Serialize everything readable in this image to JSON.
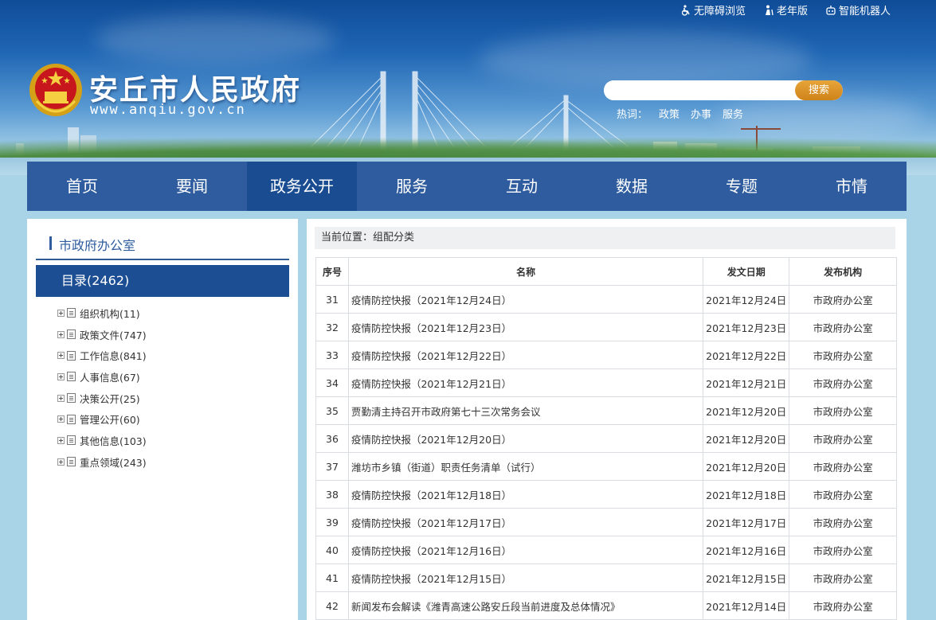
{
  "toplinks": {
    "accessible": "无障碍浏览",
    "elderly": "老年版",
    "robot": "智能机器人"
  },
  "site": {
    "title": "安丘市人民政府",
    "url": "www.anqiu.gov.cn"
  },
  "search": {
    "placeholder": "",
    "button": "搜索"
  },
  "hotwords": {
    "label": "热词：",
    "items": [
      "政策",
      "办事",
      "服务"
    ]
  },
  "nav": [
    "首页",
    "要闻",
    "政务公开",
    "服务",
    "互动",
    "数据",
    "专题",
    "市情"
  ],
  "nav_active": "政务公开",
  "sidebar": {
    "title": "市政府办公室",
    "catalog": "目录(2462)",
    "tree": [
      "组织机构(11)",
      "政策文件(747)",
      "工作信息(841)",
      "人事信息(67)",
      "决策公开(25)",
      "管理公开(60)",
      "其他信息(103)",
      "重点领域(243)"
    ]
  },
  "breadcrumb": "当前位置：组配分类",
  "table": {
    "headers": {
      "no": "序号",
      "name": "名称",
      "date": "发文日期",
      "org": "发布机构"
    },
    "rows": [
      {
        "no": "31",
        "name": "疫情防控快报（2021年12月24日）",
        "date": "2021年12月24日",
        "org": "市政府办公室"
      },
      {
        "no": "32",
        "name": "疫情防控快报（2021年12月23日）",
        "date": "2021年12月23日",
        "org": "市政府办公室"
      },
      {
        "no": "33",
        "name": "疫情防控快报（2021年12月22日）",
        "date": "2021年12月22日",
        "org": "市政府办公室"
      },
      {
        "no": "34",
        "name": "疫情防控快报（2021年12月21日）",
        "date": "2021年12月21日",
        "org": "市政府办公室"
      },
      {
        "no": "35",
        "name": "贾勤清主持召开市政府第七十三次常务会议",
        "date": "2021年12月20日",
        "org": "市政府办公室"
      },
      {
        "no": "36",
        "name": "疫情防控快报（2021年12月20日）",
        "date": "2021年12月20日",
        "org": "市政府办公室"
      },
      {
        "no": "37",
        "name": "潍坊市乡镇（街道）职责任务清单（试行）",
        "date": "2021年12月20日",
        "org": "市政府办公室"
      },
      {
        "no": "38",
        "name": "疫情防控快报（2021年12月18日）",
        "date": "2021年12月18日",
        "org": "市政府办公室"
      },
      {
        "no": "39",
        "name": "疫情防控快报（2021年12月17日）",
        "date": "2021年12月17日",
        "org": "市政府办公室"
      },
      {
        "no": "40",
        "name": "疫情防控快报（2021年12月16日）",
        "date": "2021年12月16日",
        "org": "市政府办公室"
      },
      {
        "no": "41",
        "name": "疫情防控快报（2021年12月15日）",
        "date": "2021年12月15日",
        "org": "市政府办公室"
      },
      {
        "no": "42",
        "name": "新闻发布会解读《潍青高速公路安丘段当前进度及总体情况》",
        "date": "2021年12月14日",
        "org": "市政府办公室"
      }
    ]
  },
  "colors": {
    "nav": "#2e5c9e",
    "nav_active": "#1a4c92",
    "catalog": "#1c4e93",
    "search_button": "#d98c22"
  },
  "icons": {
    "accessible": "wheelchair-icon",
    "elderly": "elderly-icon",
    "robot": "robot-icon",
    "emblem": "national-emblem-icon"
  }
}
